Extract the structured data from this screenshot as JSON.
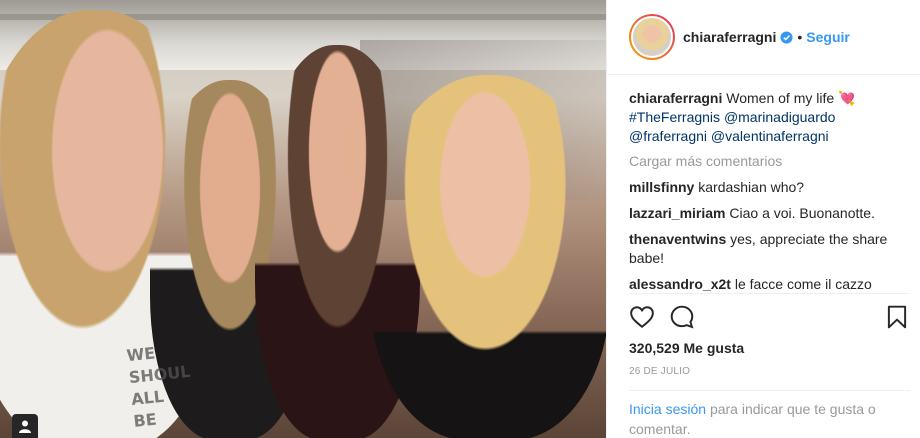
{
  "post": {
    "username": "chiaraferragni",
    "follow_label": "Seguir",
    "dot": "•",
    "caption_text": "Women of my life 💘",
    "caption_tags": [
      "#TheFerragnis",
      "@marinadiguardo",
      "@fraferragni",
      "@valentinaferragni"
    ],
    "load_more_label": "Cargar más comentarios",
    "comments": [
      {
        "user": "millsfinny",
        "text": "kardashian who?"
      },
      {
        "user": "lazzari_miriam",
        "text": "Ciao a voi. Buonanotte."
      },
      {
        "user": "thenaventwins",
        "text": "yes, appreciate the share babe!"
      },
      {
        "user": "alessandro_x2t",
        "text": "le facce come il cazzo"
      }
    ],
    "likes": "320,529 Me gusta",
    "date": "26 DE JULIO",
    "login_link": "Inicia sesión",
    "login_text": "para indicar que te gusta o comentar."
  },
  "photo": {
    "shirt_text": [
      "WE",
      "SHOUL",
      "ALL BE"
    ]
  },
  "icons": {
    "verified": "verified-badge-icon",
    "like": "heart-icon",
    "comment": "comment-bubble-icon",
    "save": "bookmark-icon",
    "user_tag": "user-tag-icon"
  },
  "colors": {
    "link": "#3897f0",
    "tag": "#003569",
    "muted": "#999999"
  }
}
